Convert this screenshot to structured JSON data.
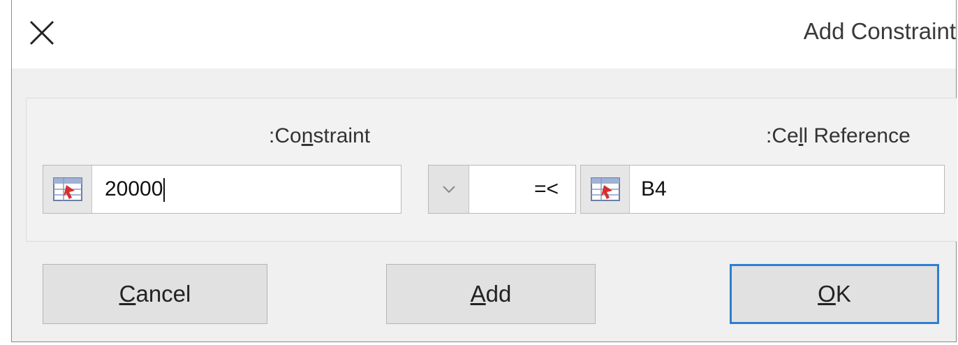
{
  "window": {
    "title": "Add Constraint"
  },
  "labels": {
    "constraint": {
      "pre": ":Co",
      "accel": "n",
      "post": "straint"
    },
    "cell_reference": {
      "pre": ":Ce",
      "accel": "l",
      "post": "l Reference"
    }
  },
  "fields": {
    "constraint_value": "20000",
    "operator": "=<",
    "cell_reference_value": "B4"
  },
  "buttons": {
    "cancel": {
      "accel": "C",
      "rest": "ancel"
    },
    "add": {
      "accel": "A",
      "rest": "dd"
    },
    "ok": {
      "accel": "O",
      "rest": "K"
    }
  },
  "colors": {
    "default_button_border": "#2e7ed1",
    "dialog_bg": "#f0f0f0"
  },
  "icons": [
    "close-icon",
    "range-select-icon",
    "chevron-down-icon"
  ]
}
